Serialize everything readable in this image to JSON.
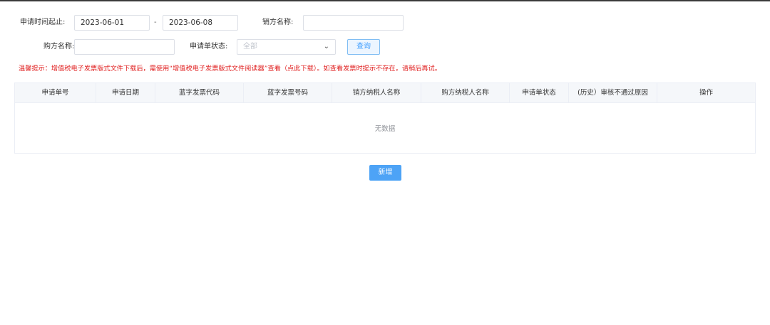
{
  "filters": {
    "date_label": "申请时间起止:",
    "date_start": "2023-06-01",
    "date_separator": "-",
    "date_end": "2023-06-08",
    "seller_label": "销方名称:",
    "seller_value": "",
    "buyer_label": "购方名称:",
    "buyer_value": "",
    "status_label": "申请单状态:",
    "status_selected": "全部",
    "query_button": "查询"
  },
  "warning": "温馨提示：增值税电子发票版式文件下载后，需使用“增值税电子发票版式文件阅读器”查看（点此下载）。如查看发票时提示不存在，请稍后再试。",
  "table": {
    "columns": [
      "申请单号",
      "申请日期",
      "蓝字发票代码",
      "蓝字发票号码",
      "销方纳税人名称",
      "购方纳税人名称",
      "申请单状态",
      "(历史）审核不通过原因",
      "操作"
    ],
    "empty_text": "无数据"
  },
  "add_button": "新增",
  "colors": {
    "warning": "#e02020",
    "primary": "#4da3f6",
    "header_bg": "#f5f7fa"
  }
}
